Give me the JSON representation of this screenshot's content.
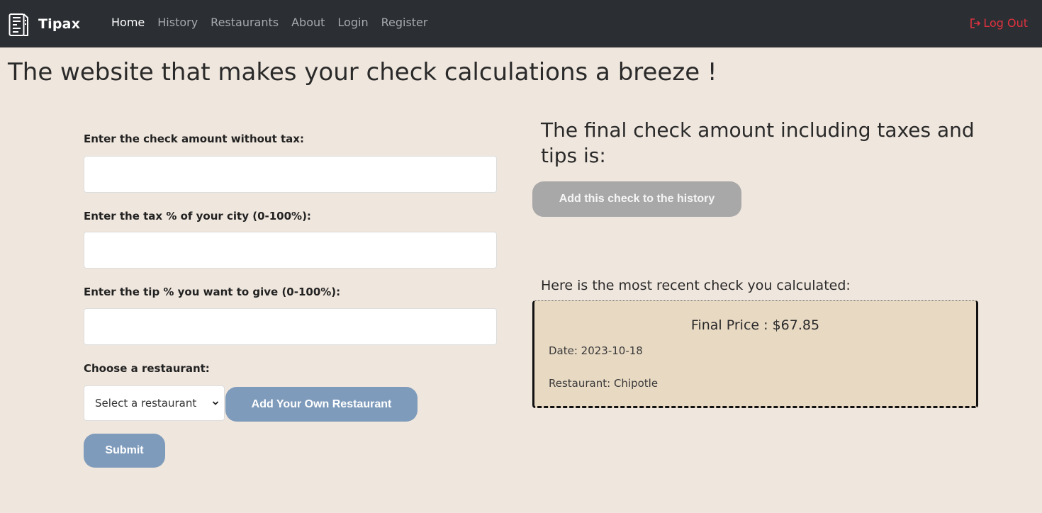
{
  "navbar": {
    "brand": "Tipax",
    "links": [
      {
        "label": "Home"
      },
      {
        "label": "History"
      },
      {
        "label": "Restaurants"
      },
      {
        "label": "About"
      },
      {
        "label": "Login"
      },
      {
        "label": "Register"
      }
    ],
    "logout_label": "Log Out",
    "brand_icon": "receipt-document-icon",
    "logout_icon": "logout-arrow-icon"
  },
  "headline": "The website that makes your check calculations a breeze !",
  "form": {
    "check_amount_label": "Enter the check amount without tax:",
    "check_amount_value": "",
    "tax_label": "Enter the tax % of your city (0-100%):",
    "tax_value": "",
    "tip_label": "Enter the tip % you want to give (0-100%):",
    "tip_value": "",
    "restaurant_label": "Choose a restaurant:",
    "restaurant_select_value": "Select a restaurant",
    "add_restaurant_label": "Add Your Own Restaurant",
    "submit_label": "Submit"
  },
  "result": {
    "heading": "The final check amount including taxes and tips is:",
    "add_history_label": "Add this check to the history",
    "recent_label": "Here is the most recent check you calculated:",
    "recent_card": {
      "price": "Final Price : $67.85",
      "date": "Date: 2023-10-18",
      "restaurant": "Restaurant: Chipotle"
    }
  },
  "colors": {
    "navbar_bg": "#2b2f33",
    "page_bg": "#efe6dd",
    "primary_button": "#7e9bbb",
    "disabled_button": "#a8a8a8",
    "logout": "#e0313f",
    "card_bg": "#e8d9c3"
  }
}
